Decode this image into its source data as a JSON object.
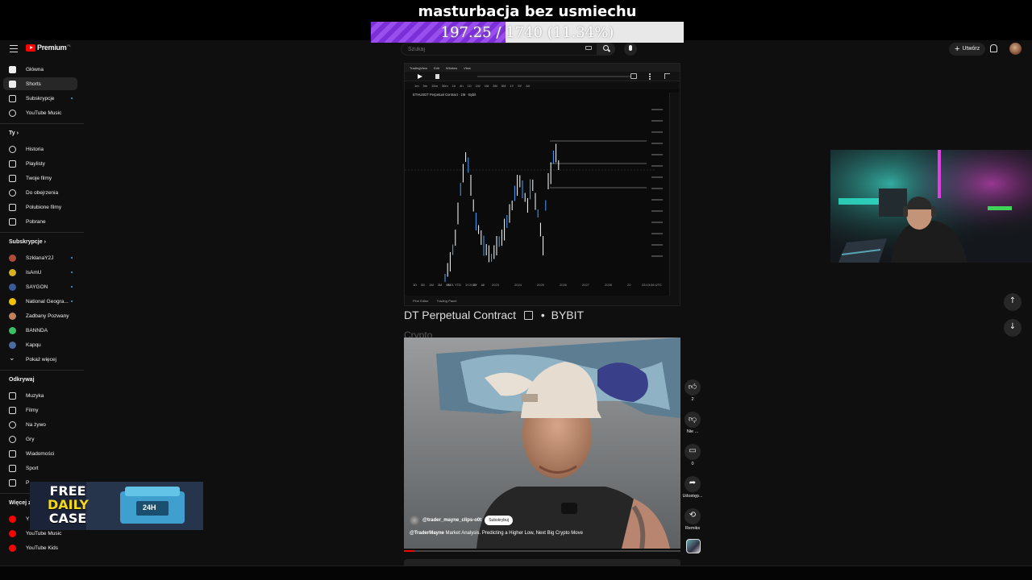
{
  "stream": {
    "title": "masturbacja bez usmiechu",
    "progress_text": "197.25 / 1740 (11.34%)",
    "progress_fraction": 0.1134
  },
  "header": {
    "logo_text": "Premium",
    "logo_sup": "PL",
    "search_placeholder": "Szukaj",
    "create_label": "Utwórz"
  },
  "sidebar": {
    "main": [
      {
        "label": "Główna",
        "icon": "home-icon"
      },
      {
        "label": "Shorts",
        "icon": "shorts-icon",
        "active": true
      },
      {
        "label": "Subskrypcje",
        "icon": "subscriptions-icon",
        "dot": true
      },
      {
        "label": "YouTube Music",
        "icon": "youtube-music-icon"
      }
    ],
    "you_heading": "Ty",
    "you": [
      {
        "label": "Historia",
        "icon": "history-icon"
      },
      {
        "label": "Playlisty",
        "icon": "playlists-icon"
      },
      {
        "label": "Twoje filmy",
        "icon": "your-videos-icon"
      },
      {
        "label": "Do obejrzenia",
        "icon": "watch-later-icon"
      },
      {
        "label": "Polubione filmy",
        "icon": "liked-icon"
      },
      {
        "label": "Pobrane",
        "icon": "download-icon"
      }
    ],
    "subs_heading": "Subskrypcje",
    "subs": [
      {
        "label": "SzklanaY2J",
        "color": "#b04a3a",
        "dot": true
      },
      {
        "label": "IsAmU",
        "color": "#d8b020",
        "dot": true
      },
      {
        "label": "SAYGON",
        "color": "#3a5a9a",
        "dot": true
      },
      {
        "label": "National Geogra...",
        "color": "#f2c200",
        "dot": true
      },
      {
        "label": "Zadbany Pozwany",
        "color": "#c08060",
        "dot": false
      },
      {
        "label": "BANNDA",
        "color": "#3ac060",
        "dot": false
      },
      {
        "label": "Kapqu",
        "color": "#4a6aa0",
        "dot": false
      },
      {
        "label": "Pokaż więcej",
        "icon": "chevron-down-icon"
      }
    ],
    "explore_heading": "Odkrywaj",
    "explore": [
      {
        "label": "Muzyka",
        "icon": "music-icon"
      },
      {
        "label": "Filmy",
        "icon": "movies-icon"
      },
      {
        "label": "Na żywo",
        "icon": "live-icon"
      },
      {
        "label": "Gry",
        "icon": "gaming-icon"
      },
      {
        "label": "Wiadomości",
        "icon": "news-icon"
      },
      {
        "label": "Sport",
        "icon": "trophy-icon"
      },
      {
        "label": "P",
        "icon": "bulb-icon"
      }
    ],
    "more_heading": "Więcej z",
    "more": [
      {
        "label": "Y",
        "icon": "youtube-red-icon"
      },
      {
        "label": "YouTube Music",
        "icon": "youtube-music-red-icon"
      },
      {
        "label": "YouTube Kids",
        "icon": "youtube-kids-red-icon"
      }
    ]
  },
  "tradingview": {
    "menu": [
      "TradingView",
      "Edit",
      "Window",
      "View"
    ],
    "timeframes": [
      "1m",
      "5m",
      "15m",
      "30m",
      "1h",
      "4h",
      "1D",
      "1W",
      "1M",
      "3M",
      "6M",
      "1Y",
      "5Y",
      "All"
    ],
    "symbol": "ETHUSDT Perpetual Contract · 1M · Bybit",
    "years": [
      "2021",
      "2022",
      "2023",
      "2024",
      "2025",
      "2026",
      "2027",
      "2028",
      "20"
    ],
    "bottom_tabs": [
      "Pine Editor",
      "Trading Panel"
    ],
    "ranges": [
      "1D",
      "5D",
      "1M",
      "3M",
      "6M",
      "YTD",
      "1Y",
      "5Y",
      "All"
    ],
    "clock": "23:13:26 UTC"
  },
  "contract": {
    "text": "DT Perpetual Contract",
    "exchange": "BYBIT",
    "sub": "Crypto"
  },
  "short": {
    "channel": "@trader_mayne_clips-o0t",
    "subscribe_label": "Subskrybuj",
    "title_author": "@TraderMayne",
    "title": "Market Analysis. Predicting a Higher Low, Next Big Crypto Move",
    "progress_fraction": 0.035
  },
  "actions": {
    "like_count": "2",
    "dislike_label": "Nie ...",
    "comments_count": "0",
    "share_label": "Udostęp...",
    "remix_label": "Remiks"
  },
  "promo": {
    "line1": "FREE",
    "line2": "DAILY",
    "line3": "CASE",
    "badge": "24H"
  },
  "colors": {
    "accent": "#ff0000",
    "progress_purple": "#7b2fd6",
    "candle_up": "#ffffff",
    "candle_down": "#4aa3ff"
  }
}
